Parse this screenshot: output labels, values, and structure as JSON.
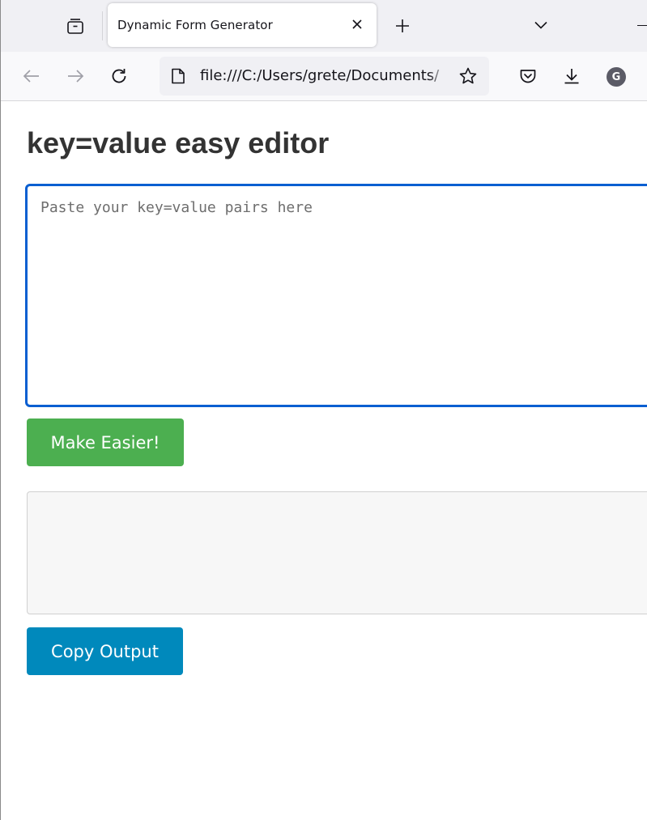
{
  "browser": {
    "tab": {
      "title": "Dynamic Form Generator"
    },
    "url": "file:///C:/Users/grete/Documents/",
    "profile_initial": "G",
    "icons": {
      "tab_overview": "firefox-view-icon",
      "tab_close": "close-icon",
      "new_tab": "plus-icon",
      "tab_list": "chevron-down-icon",
      "back": "arrow-left-icon",
      "forward": "arrow-right-icon",
      "reload": "reload-icon",
      "page": "page-icon",
      "bookmark": "star-icon",
      "pocket": "pocket-icon",
      "downloads": "download-icon"
    }
  },
  "page": {
    "title": "key=value easy editor",
    "input": {
      "value": "",
      "placeholder": "Paste your key=value pairs here"
    },
    "make_easier_label": "Make Easier!",
    "output_text": "",
    "copy_label": "Copy Output"
  },
  "colors": {
    "make_easier_button": "#4caf50",
    "copy_button": "#0089bc",
    "input_focus_border": "#0b5fd1",
    "title_text": "#333333"
  }
}
